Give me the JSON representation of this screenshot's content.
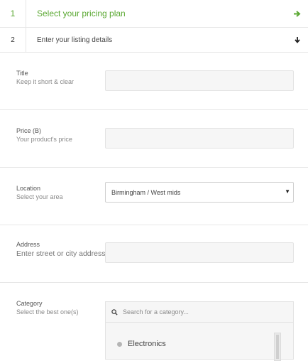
{
  "steps": [
    {
      "num": "1",
      "title": "Select your pricing plan",
      "arrow": "➔"
    },
    {
      "num": "2",
      "title": "Enter your listing details",
      "arrow": "🡫"
    }
  ],
  "fields": {
    "title": {
      "label": "Title",
      "help": "Keep it short & clear",
      "value": ""
    },
    "price": {
      "label": "Price (B)",
      "help": "Your product's price",
      "value": ""
    },
    "location": {
      "label": "Location",
      "help": "Select your area",
      "value": "Birmingham / West mids"
    },
    "address": {
      "label": "Address",
      "help": "Enter street or city address",
      "value": ""
    },
    "category": {
      "label": "Category",
      "help": "Select the best one(s)"
    }
  },
  "category_search": {
    "placeholder": "Search for a category..."
  },
  "categories": [
    "Electronics"
  ],
  "colors": {
    "accent": "#5aa832"
  }
}
